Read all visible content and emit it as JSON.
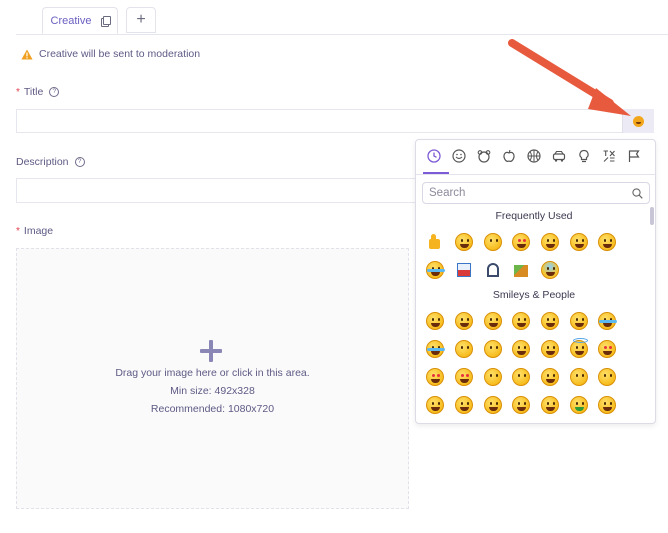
{
  "tabs": {
    "active_label": "Creative",
    "add_label": "+"
  },
  "warning": {
    "text": "Creative will be sent to moderation"
  },
  "form": {
    "title_label": "Title",
    "title_required": "*",
    "title_value": "",
    "description_label": "Description",
    "description_value": "",
    "image_label": "Image",
    "image_required": "*",
    "help_glyph": "?"
  },
  "upload": {
    "line1": "Drag your image here or click in this area.",
    "line2": "Min size: 492x328",
    "line3": "Recommended: 1080x720"
  },
  "emoji_picker": {
    "search_placeholder": "Search",
    "section_frequent": "Frequently Used",
    "section_smileys": "Smileys & People",
    "categories": [
      "recent-clock-icon",
      "smiley-icon",
      "animal-icon",
      "food-apple-icon",
      "sports-ball-icon",
      "car-icon",
      "lightbulb-icon",
      "symbols-icon",
      "flag-icon"
    ],
    "accent_color": "#7d5bd6"
  },
  "colors": {
    "accent": "#6a5fc1",
    "warning": "#f0a020",
    "arrow": "#e85a3e",
    "required": "#e0424f"
  }
}
